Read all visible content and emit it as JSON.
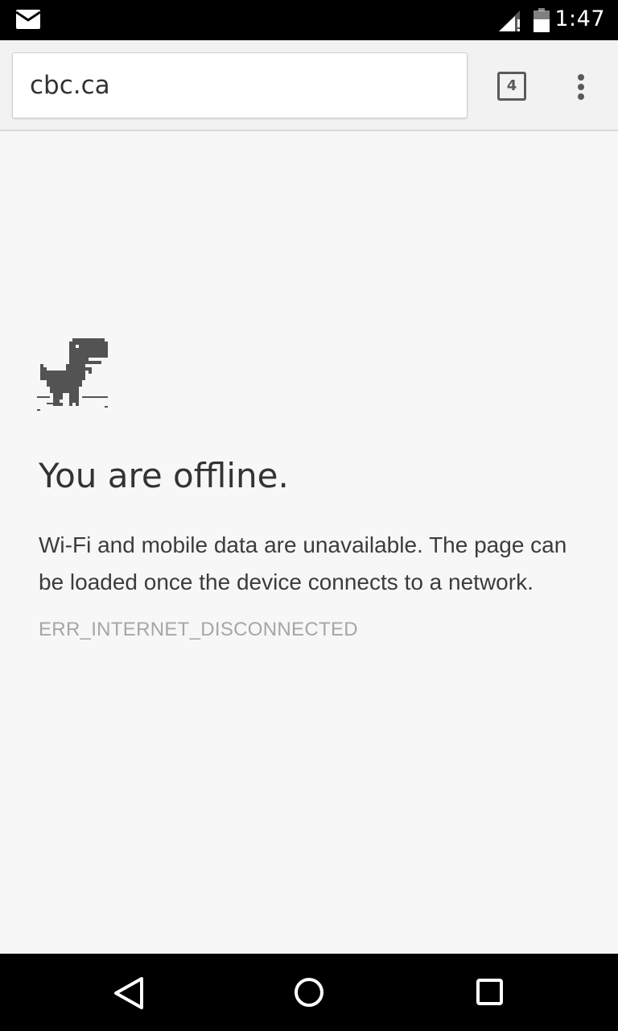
{
  "status_bar": {
    "time": "1:47",
    "icons": [
      "mail-icon",
      "signal-icon",
      "battery-icon"
    ]
  },
  "toolbar": {
    "url": "cbc.ca",
    "tab_count": "4",
    "icons": [
      "tab-switcher-icon",
      "overflow-menu-icon"
    ]
  },
  "error_page": {
    "illustration": "offline-dinosaur-icon",
    "heading": "You are offline.",
    "message": "Wi-Fi and mobile data are unavailable. The page can be loaded once the device connects to a network.",
    "error_code": "ERR_INTERNET_DISCONNECTED"
  },
  "nav_bar": {
    "icons": [
      "back-icon",
      "home-icon",
      "recents-icon"
    ]
  },
  "colors": {
    "status_bar_bg": "#000000",
    "toolbar_bg": "#f2f2f2",
    "page_bg": "#f7f7f7",
    "text_primary": "#333333",
    "text_muted": "#a6a6a6",
    "dino": "#535353"
  }
}
